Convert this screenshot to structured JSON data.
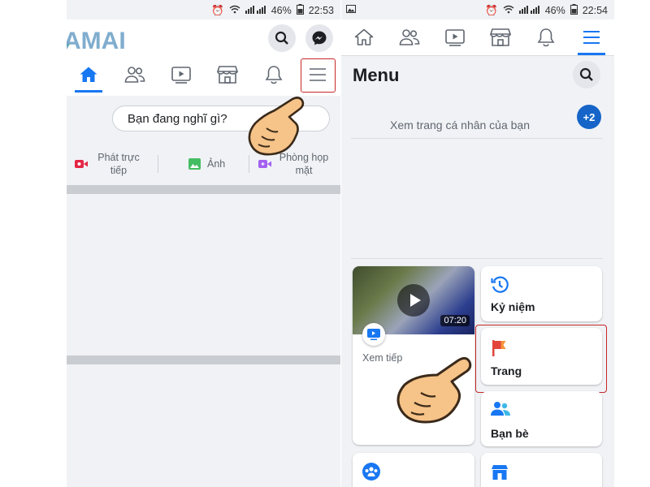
{
  "left": {
    "status": {
      "battery": "46%",
      "time": "22:53"
    },
    "logo": "AMAI",
    "tabs": [
      {
        "name": "home-icon",
        "active": true
      },
      {
        "name": "friends-icon"
      },
      {
        "name": "watch-icon"
      },
      {
        "name": "marketplace-icon"
      },
      {
        "name": "bell-icon"
      },
      {
        "name": "menu-icon",
        "highlighted": true
      }
    ],
    "composer_placeholder": "Bạn đang nghĩ gì?",
    "actions": {
      "live": "Phát trực tiếp",
      "photo": "Ảnh",
      "room": "Phòng họp mặt"
    }
  },
  "right": {
    "status": {
      "battery": "46%",
      "time": "22:54"
    },
    "menu_title": "Menu",
    "profile_text": "Xem trang cá nhân của bạn",
    "badge": "+2",
    "watch": {
      "duration": "07:20",
      "label": "Xem tiếp"
    },
    "cards": {
      "memories": "Kỷ niệm",
      "pages": "Trang",
      "friends": "Bạn bè"
    }
  },
  "colors": {
    "accent": "#1877f2",
    "highlight": "#c62828",
    "badge": "#1664c8"
  }
}
